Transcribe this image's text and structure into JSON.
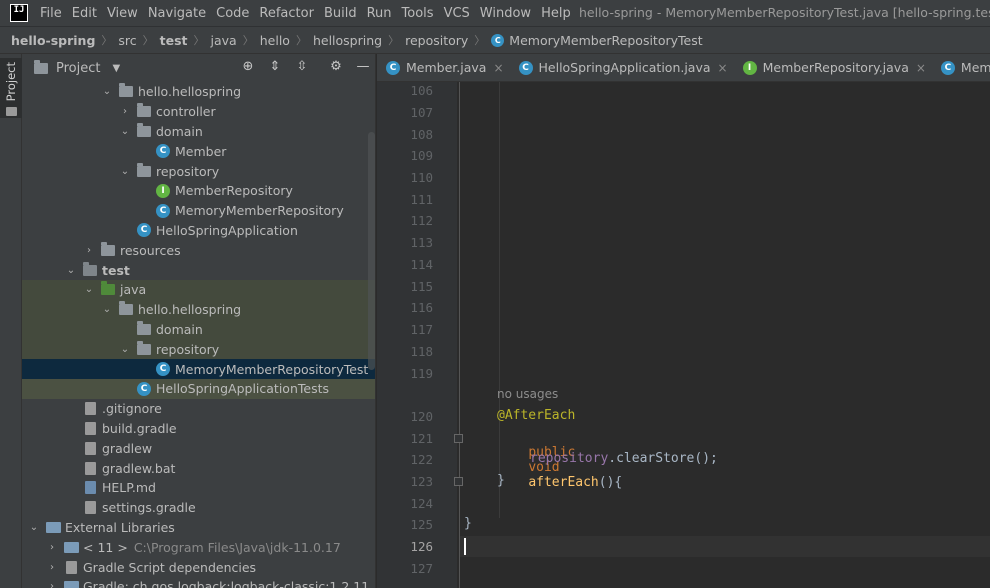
{
  "menubar": {
    "logo": "IJ",
    "items": [
      "File",
      "Edit",
      "View",
      "Navigate",
      "Code",
      "Refactor",
      "Build",
      "Run",
      "Tools",
      "VCS",
      "Window",
      "Help"
    ],
    "title": "hello-spring - MemoryMemberRepositoryTest.java [hello-spring.test]"
  },
  "breadcrumb": [
    "hello-spring",
    "src",
    "test",
    "java",
    "hello",
    "hellospring",
    "repository",
    "MemoryMemberRepositoryTest"
  ],
  "sidebar": {
    "label": "Project"
  },
  "panel": {
    "title": "Project"
  },
  "tree": [
    {
      "label": "hello.hellospring",
      "arrow": "v"
    },
    {
      "label": "controller",
      "arrow": ">"
    },
    {
      "label": "domain",
      "arrow": "v"
    },
    {
      "label": "Member",
      "arrow": ""
    },
    {
      "label": "repository",
      "arrow": "v"
    },
    {
      "label": "MemberRepository",
      "arrow": ""
    },
    {
      "label": "MemoryMemberRepository",
      "arrow": ""
    },
    {
      "label": "HelloSpringApplication",
      "arrow": ""
    },
    {
      "label": "resources",
      "arrow": ">"
    },
    {
      "label": "test",
      "arrow": "v"
    },
    {
      "label": "java",
      "arrow": "v"
    },
    {
      "label": "hello.hellospring",
      "arrow": "v"
    },
    {
      "label": "domain",
      "arrow": ""
    },
    {
      "label": "repository",
      "arrow": "v"
    },
    {
      "label": "MemoryMemberRepositoryTest",
      "arrow": ""
    },
    {
      "label": "HelloSpringApplicationTests",
      "arrow": ""
    },
    {
      "label": ".gitignore",
      "arrow": ""
    },
    {
      "label": "build.gradle",
      "arrow": ""
    },
    {
      "label": "gradlew",
      "arrow": ""
    },
    {
      "label": "gradlew.bat",
      "arrow": ""
    },
    {
      "label": "HELP.md",
      "arrow": ""
    },
    {
      "label": "settings.gradle",
      "arrow": ""
    },
    {
      "label": "External Libraries",
      "arrow": "v"
    },
    {
      "label": "< 11 >",
      "extra": "C:\\Program Files\\Java\\jdk-11.0.17",
      "arrow": ">"
    },
    {
      "label": "Gradle Script dependencies",
      "arrow": ">"
    },
    {
      "label": "Gradle: ch.qos.logback:logback-classic:1.2.11",
      "arrow": ">"
    }
  ],
  "tabs": [
    {
      "label": "Member.java",
      "close": "×"
    },
    {
      "label": "HelloSpringApplication.java",
      "close": "×"
    },
    {
      "label": "MemberRepository.java",
      "close": "×"
    },
    {
      "label": "MemoryMemb",
      "close": ""
    }
  ],
  "editor": {
    "lines": [
      "106",
      "107",
      "108",
      "109",
      "110",
      "111",
      "112",
      "113",
      "114",
      "115",
      "116",
      "117",
      "118",
      "119",
      "120",
      "121",
      "122",
      "123",
      "124",
      "125",
      "126",
      "127"
    ],
    "hint": "no usages",
    "annotation": "@AfterEach",
    "kw_public": "public",
    "kw_void": "void",
    "method": "afterEach",
    "paren": "(){",
    "field": "repository",
    "call": ".clearStore();",
    "close_inner": "}",
    "close_outer": "}"
  },
  "colors": {
    "annotation": "#bbb529",
    "keyword": "#cc7832",
    "method": "#ffc66d",
    "field": "#9876aa",
    "text": "#a9b7c6"
  }
}
